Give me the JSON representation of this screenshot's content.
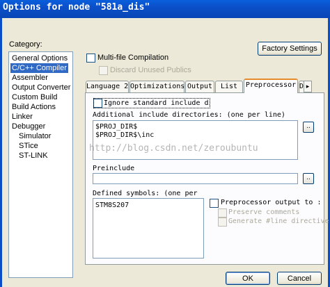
{
  "window": {
    "title": "Options for node \"581a_dis\""
  },
  "category": {
    "label": "Category:",
    "items": [
      {
        "label": "General Options",
        "indent": 0
      },
      {
        "label": "C/C++ Compiler",
        "indent": 0,
        "selected": true
      },
      {
        "label": "Assembler",
        "indent": 0
      },
      {
        "label": "Output Converter",
        "indent": 0
      },
      {
        "label": "Custom Build",
        "indent": 0
      },
      {
        "label": "Build Actions",
        "indent": 0
      },
      {
        "label": "Linker",
        "indent": 0
      },
      {
        "label": "Debugger",
        "indent": 0
      },
      {
        "label": "Simulator",
        "indent": 1
      },
      {
        "label": "STice",
        "indent": 1
      },
      {
        "label": "ST-LINK",
        "indent": 1
      }
    ]
  },
  "top": {
    "multi_file": "Multi-file Compilation",
    "discard": "Discard Unused Publics",
    "factory": "Factory Settings"
  },
  "tabs": [
    "Language 2",
    "Optimizations",
    "Output",
    "List",
    "Preprocessor",
    "D"
  ],
  "preprocessor": {
    "ignore": "Ignore standard include direc",
    "include_label": "Additional include directories: (one per line)",
    "include_dirs": [
      "$PROJ_DIR$",
      "$PROJ_DIR$\\inc"
    ],
    "preinclude_label": "Preinclude",
    "preinclude_value": "",
    "defined_label": "Defined symbols: (one per",
    "defined_value": "STM8S207",
    "pp_output": "Preprocessor output to :",
    "preserve": "Preserve comments",
    "generate": "Generate #line directive",
    "ellipsis": ".."
  },
  "watermark": "http://blog.csdn.net/zeroubuntu",
  "buttons": {
    "ok": "OK",
    "cancel": "Cancel"
  },
  "colors": {
    "title_bar": "#0b4fc8",
    "selection": "#316ac5",
    "active_tab": "#e68b2c"
  }
}
